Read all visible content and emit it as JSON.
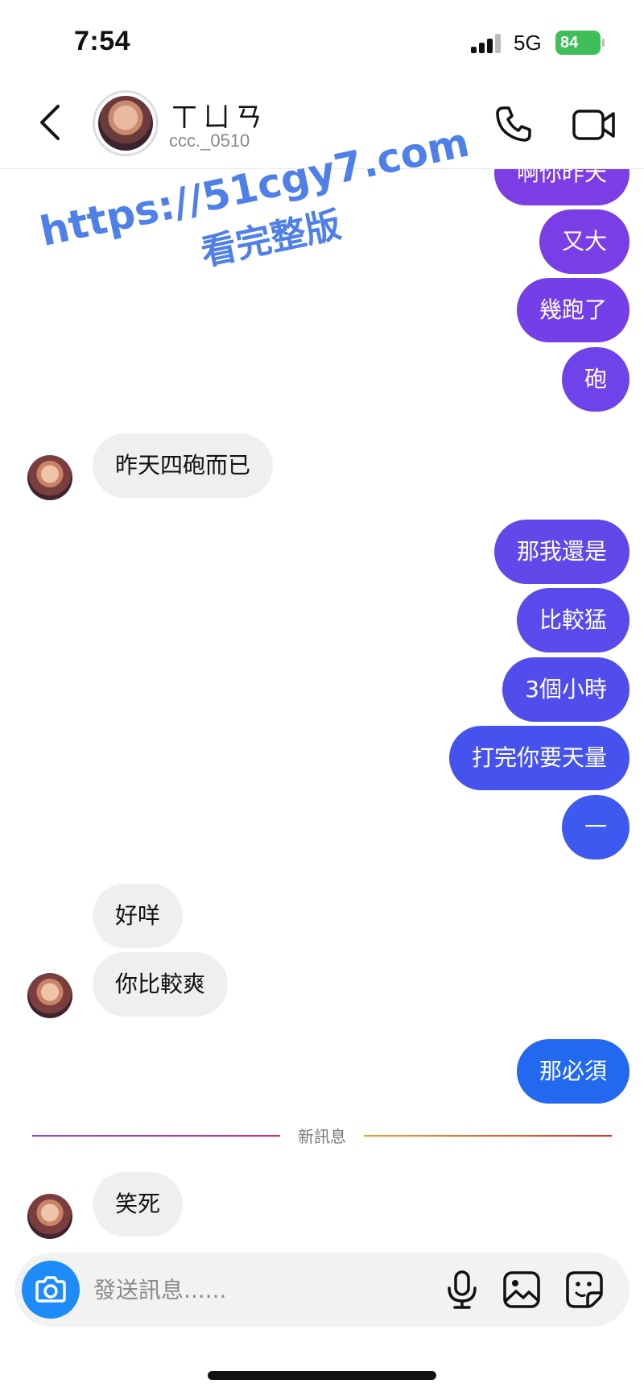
{
  "status_bar": {
    "time": "7:54",
    "network": "5G",
    "battery": "84"
  },
  "header": {
    "name": "ㄒㄩㄢ",
    "handle": "ccc._0510"
  },
  "watermark": {
    "url": "https://51cgy7.com",
    "subtitle": "看完整版"
  },
  "messages": {
    "m0": "啊你昨天",
    "m1": "又大",
    "m2": "幾跑了",
    "m3": "砲",
    "m4": "昨天四砲而已",
    "m5": "那我還是",
    "m6": "比較猛",
    "m7": "3個小時",
    "m8": "打完你要天量",
    "m9": "一",
    "m10": "好咩",
    "m11": "你比較爽",
    "m12": "那必須",
    "m13": "笑死"
  },
  "divider": {
    "label": "新訊息"
  },
  "composer": {
    "placeholder": "發送訊息......"
  },
  "colors": {
    "outgoing_gradient_top": "#7a3fe6",
    "outgoing_gradient_bottom": "#1f74f0",
    "incoming_bubble": "#efefef",
    "camera_button": "#1d8cf8",
    "watermark": "#4f7fe8"
  }
}
